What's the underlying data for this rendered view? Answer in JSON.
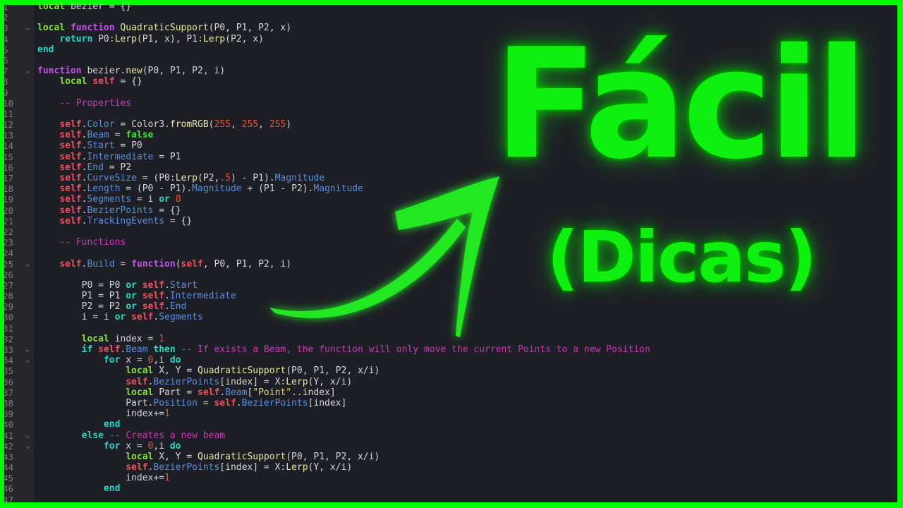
{
  "editor": {
    "fold_lines": [
      3,
      7,
      25,
      33,
      34,
      41,
      42
    ],
    "lines": [
      "⟦l|local⟧ bezier = {}",
      "",
      "⟦l|local⟧ ⟦f|function⟧ ⟦fn|QuadraticSupport⟧(P0, P1, P2, x)",
      "    ⟦k|return⟧ P0:⟦fn|Lerp⟧(P1, x), P1:⟦fn|Lerp⟧(P2, x)",
      "⟦k|end⟧",
      "",
      "⟦f|function⟧ bezier.⟦fn|new⟧(P0, P1, P2, i)",
      "    ⟦l|local⟧ ⟦s|self⟧ = {}",
      "",
      "    ⟦c|-- Properties⟧",
      "",
      "    ⟦s|self⟧.⟦p|Color⟧ = Color3.⟦fn|fromRGB⟧(⟦n|255⟧, ⟦n|255⟧, ⟦n|255⟧)",
      "    ⟦s|self⟧.⟦p|Beam⟧ = ⟦b|false⟧",
      "    ⟦s|self⟧.⟦p|Start⟧ = P0",
      "    ⟦s|self⟧.⟦p|Intermediate⟧ = P1",
      "    ⟦s|self⟧.⟦p|End⟧ = P2",
      "    ⟦s|self⟧.⟦p|CurveSize⟧ = (P0:⟦fn|Lerp⟧(P2,⟦n|.5⟧) - P1).⟦p|Magnitude⟧",
      "    ⟦s|self⟧.⟦p|Length⟧ = (P0 - P1).⟦p|Magnitude⟧ + (P1 - P2).⟦p|Magnitude⟧",
      "    ⟦s|self⟧.⟦p|Segments⟧ = i ⟦k|or⟧ ⟦n|8⟧",
      "    ⟦s|self⟧.⟦p|BezierPoints⟧ = {}",
      "    ⟦s|self⟧.⟦p|TrackingEvents⟧ = {}",
      "",
      "    ⟦c|-- Functions⟧",
      "",
      "    ⟦s|self⟧.⟦p|Build⟧ = ⟦f|function⟧(⟦s|self⟧, P0, P1, P2, i)",
      "",
      "        P0 = P0 ⟦k|or⟧ ⟦s|self⟧.⟦p|Start⟧",
      "        P1 = P1 ⟦k|or⟧ ⟦s|self⟧.⟦p|Intermediate⟧",
      "        P2 = P2 ⟦k|or⟧ ⟦s|self⟧.⟦p|End⟧",
      "        i = i ⟦k|or⟧ ⟦s|self⟧.⟦p|Segments⟧",
      "",
      "        ⟦l|local⟧ index = ⟦n|1⟧",
      "        ⟦k|if⟧ ⟦s|self⟧.⟦p|Beam⟧ ⟦k|then⟧ ⟦c|-- If exists a Beam, the function will only move the current Points to a new Position⟧",
      "            ⟦k|for⟧ x = ⟦n|0⟧,i ⟦k|do⟧",
      "                ⟦l|local⟧ X, Y = ⟦fn|QuadraticSupport⟧(P0, P1, P2, x/i)",
      "                ⟦s|self⟧.⟦p|BezierPoints⟧[index] = X:⟦fn|Lerp⟧(Y, x/i)",
      "                ⟦l|local⟧ Part = ⟦s|self⟧.⟦p|Beam⟧[⟦str|\"Point\"⟧..index]",
      "                Part.⟦p|Position⟧ = ⟦s|self⟧.⟦p|BezierPoints⟧[index]",
      "                index+=⟦n|1⟧",
      "            ⟦k|end⟧",
      "        ⟦k|else⟧ ⟦c|-- Creates a new beam⟧",
      "            ⟦k|for⟧ x = ⟦n|0⟧,i ⟦k|do⟧",
      "                ⟦l|local⟧ X, Y = ⟦fn|QuadraticSupport⟧(P0, P1, P2, x/i)",
      "                ⟦s|self⟧.⟦p|BezierPoints⟧[index] = X:⟦fn|Lerp⟧(Y, x/i)",
      "                index+=⟦n|1⟧",
      "            ⟦k|end⟧",
      ""
    ]
  },
  "thumbnail": {
    "title": "Fácil",
    "subtitle": "(Dicas)",
    "accent": "#00ff00",
    "arrow_icon": "curved-arrow-icon"
  }
}
